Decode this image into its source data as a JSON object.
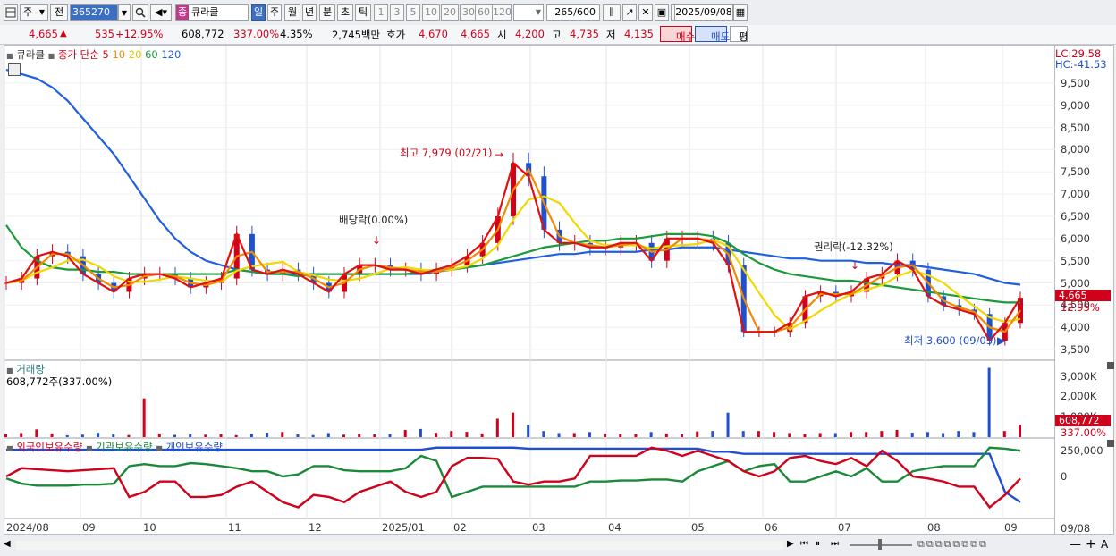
{
  "toolbar": {
    "period_unit": "주",
    "prev_label": "전",
    "code": "365270",
    "stock_name": "큐라클",
    "market_badge": "종",
    "periods": [
      "일",
      "주",
      "월",
      "년",
      "분",
      "초",
      "틱"
    ],
    "intervals": [
      "1",
      "3",
      "5",
      "10",
      "20",
      "30",
      "60",
      "120"
    ],
    "count": "265",
    "count_total": "/600",
    "date": "2025/09/08"
  },
  "quote": {
    "price": "4,665",
    "change": "535",
    "change_pct": "+12.95%",
    "volume": "608,772",
    "vol_ratio": "337.00%",
    "turnover": "4.35%",
    "amount": "2,745백만",
    "ask_label": "호가",
    "ask": "4,670",
    "bid": "4,665",
    "open_label": "시",
    "open": "4,200",
    "high_label": "고",
    "high": "4,735",
    "low_label": "저",
    "low": "4,135",
    "buy_label": "매수",
    "sell_label": "매도",
    "eval_label": "평"
  },
  "price_panel": {
    "name": "큐라클",
    "ma_label": "종가 단순",
    "ma_periods": [
      "5",
      "10",
      "20",
      "60",
      "120"
    ],
    "ma_colors": {
      "5": "#e01010",
      "10": "#f08a00",
      "20": "#f0d800",
      "60": "#1a9a3a",
      "120": "#2060e0"
    },
    "lc": "LC:29.58",
    "hc": "HC:-41.53",
    "yticks": [
      "9,500",
      "9,000",
      "8,500",
      "8,000",
      "7,500",
      "7,000",
      "6,500",
      "6,000",
      "5,500",
      "5,000",
      "4,500",
      "4,000",
      "3,500"
    ],
    "last_price_tag": "4,665",
    "last_pct_tag": "12.95%",
    "annot_high": "최고 7,979 (02/21)",
    "annot_low": "최저 3,600 (09/03)",
    "annot_div": "배당락(0.00%)",
    "annot_rights": "권리락(-12.32%)"
  },
  "volume_panel": {
    "title": "거래량",
    "value_label": "608,772주(337.00%)",
    "yticks": [
      "3,000K",
      "2,000K",
      "1,000K"
    ],
    "tag_value": "608,772",
    "tag_pct": "337.00%"
  },
  "holding_panel": {
    "labels": [
      "외국인보유수량",
      "기관보유수량",
      "개인보유수량"
    ],
    "colors": [
      "#d0021b",
      "#1a8a3a",
      "#2050d0"
    ],
    "yticks": [
      "250,000",
      "0"
    ]
  },
  "xaxis": {
    "labels": [
      "2024/08",
      "09",
      "10",
      "11",
      "12",
      "2025/01",
      "02",
      "03",
      "04",
      "05",
      "06",
      "07",
      "08",
      "09"
    ],
    "right_label": "09/08"
  },
  "chart_data": {
    "type": "line",
    "price_axis": {
      "ylim": [
        3300,
        9900
      ]
    },
    "price_series": [
      {
        "name": "5",
        "values": [
          5000,
          5100,
          5600,
          5700,
          5600,
          5200,
          5000,
          4800,
          5100,
          5200,
          5200,
          5100,
          4900,
          5000,
          5100,
          6100,
          5300,
          5200,
          5300,
          5200,
          5000,
          4800,
          5200,
          5400,
          5400,
          5300,
          5300,
          5200,
          5300,
          5400,
          5600,
          5900,
          6500,
          7700,
          7400,
          6200,
          5900,
          5900,
          5800,
          5800,
          5900,
          5900,
          5500,
          6000,
          6000,
          6000,
          5900,
          5400,
          3900,
          3900,
          3900,
          4100,
          4700,
          4800,
          4700,
          4800,
          5100,
          5200,
          5500,
          5300,
          4700,
          4500,
          4400,
          4300,
          3700,
          4100,
          4665
        ]
      },
      {
        "name": "60",
        "values": [
          6300,
          5800,
          5500,
          5350,
          5300,
          5300,
          5250,
          5250,
          5200,
          5200,
          5200,
          5200,
          5200,
          5200,
          5200,
          5300,
          5250,
          5200,
          5200,
          5150,
          5200,
          5200,
          5200,
          5200,
          5200,
          5200,
          5200,
          5250,
          5300,
          5300,
          5350,
          5400,
          5500,
          5600,
          5700,
          5800,
          5850,
          5900,
          5950,
          5950,
          6000,
          6000,
          6050,
          6100,
          6100,
          6100,
          6050,
          5900,
          5650,
          5450,
          5300,
          5200,
          5150,
          5100,
          5050,
          5050,
          5000,
          4950,
          4900,
          4850,
          4800,
          4750,
          4700,
          4650,
          4600,
          4560,
          4560
        ]
      },
      {
        "name": "120",
        "values": [
          9800,
          9700,
          9600,
          9400,
          9100,
          8700,
          8300,
          7900,
          7400,
          6900,
          6400,
          6000,
          5700,
          5500,
          5400,
          5300,
          5250,
          5200,
          5200,
          5200,
          5200,
          5200,
          5200,
          5200,
          5200,
          5200,
          5200,
          5200,
          5250,
          5300,
          5350,
          5400,
          5450,
          5500,
          5550,
          5600,
          5650,
          5650,
          5700,
          5700,
          5700,
          5700,
          5750,
          5750,
          5800,
          5800,
          5800,
          5750,
          5700,
          5650,
          5600,
          5550,
          5550,
          5500,
          5500,
          5500,
          5450,
          5450,
          5400,
          5400,
          5350,
          5300,
          5250,
          5200,
          5100,
          5000,
          4960
        ]
      }
    ],
    "volume_axis": {
      "ylim": [
        0,
        3600
      ]
    },
    "volume_k": [
      150,
      200,
      380,
      180,
      90,
      120,
      210,
      140,
      100,
      1900,
      180,
      110,
      150,
      120,
      150,
      95,
      160,
      220,
      250,
      130,
      100,
      200,
      120,
      150,
      130,
      150,
      350,
      400,
      210,
      300,
      260,
      180,
      900,
      1200,
      600,
      300,
      200,
      200,
      250,
      160,
      150,
      150,
      250,
      180,
      150,
      280,
      300,
      1200,
      300,
      300,
      250,
      200,
      150,
      200,
      200,
      250,
      250,
      300,
      350,
      220,
      250,
      200,
      300,
      250,
      3400,
      300,
      609
    ],
    "holding_axis": {
      "ylim": [
        -400000,
        330000
      ]
    },
    "holding_series": [
      {
        "name": "외국인보유수량",
        "values": [
          0,
          80000,
          70000,
          60000,
          50000,
          60000,
          70000,
          80000,
          -200000,
          -150000,
          -50000,
          -50000,
          -200000,
          -200000,
          -180000,
          -100000,
          -50000,
          -150000,
          -250000,
          -300000,
          -180000,
          -200000,
          -250000,
          -150000,
          -100000,
          -50000,
          -150000,
          -200000,
          -150000,
          100000,
          180000,
          180000,
          170000,
          -50000,
          -80000,
          -50000,
          -50000,
          -20000,
          200000,
          200000,
          200000,
          200000,
          280000,
          250000,
          200000,
          250000,
          200000,
          150000,
          50000,
          0,
          50000,
          180000,
          200000,
          150000,
          120000,
          180000,
          100000,
          250000,
          150000,
          0,
          -20000,
          -50000,
          -100000,
          -100000,
          -300000,
          -180000,
          -20000
        ]
      },
      {
        "name": "기관보유수량",
        "values": [
          -20000,
          -70000,
          -90000,
          -90000,
          -90000,
          -80000,
          -80000,
          -70000,
          100000,
          120000,
          100000,
          100000,
          130000,
          120000,
          100000,
          80000,
          50000,
          50000,
          0,
          20000,
          100000,
          100000,
          60000,
          50000,
          50000,
          50000,
          80000,
          200000,
          150000,
          -200000,
          -150000,
          -100000,
          -100000,
          -100000,
          -100000,
          -100000,
          -100000,
          -100000,
          -50000,
          -50000,
          -40000,
          -40000,
          -30000,
          -30000,
          -50000,
          50000,
          100000,
          150000,
          50000,
          100000,
          120000,
          -50000,
          -50000,
          0,
          50000,
          0,
          80000,
          -50000,
          -50000,
          50000,
          80000,
          100000,
          100000,
          100000,
          280000,
          270000,
          250000
        ]
      },
      {
        "name": "개인보유수량",
        "values": [
          260000,
          260000,
          260000,
          260000,
          260000,
          260000,
          260000,
          260000,
          260000,
          260000,
          260000,
          260000,
          260000,
          260000,
          260000,
          260000,
          260000,
          260000,
          260000,
          260000,
          260000,
          260000,
          260000,
          260000,
          260000,
          260000,
          260000,
          260000,
          280000,
          280000,
          280000,
          280000,
          280000,
          280000,
          270000,
          270000,
          270000,
          270000,
          270000,
          270000,
          270000,
          270000,
          270000,
          270000,
          270000,
          270000,
          240000,
          240000,
          220000,
          220000,
          220000,
          220000,
          220000,
          220000,
          220000,
          220000,
          220000,
          220000,
          220000,
          220000,
          220000,
          220000,
          220000,
          220000,
          220000,
          -150000,
          -250000
        ]
      }
    ]
  }
}
